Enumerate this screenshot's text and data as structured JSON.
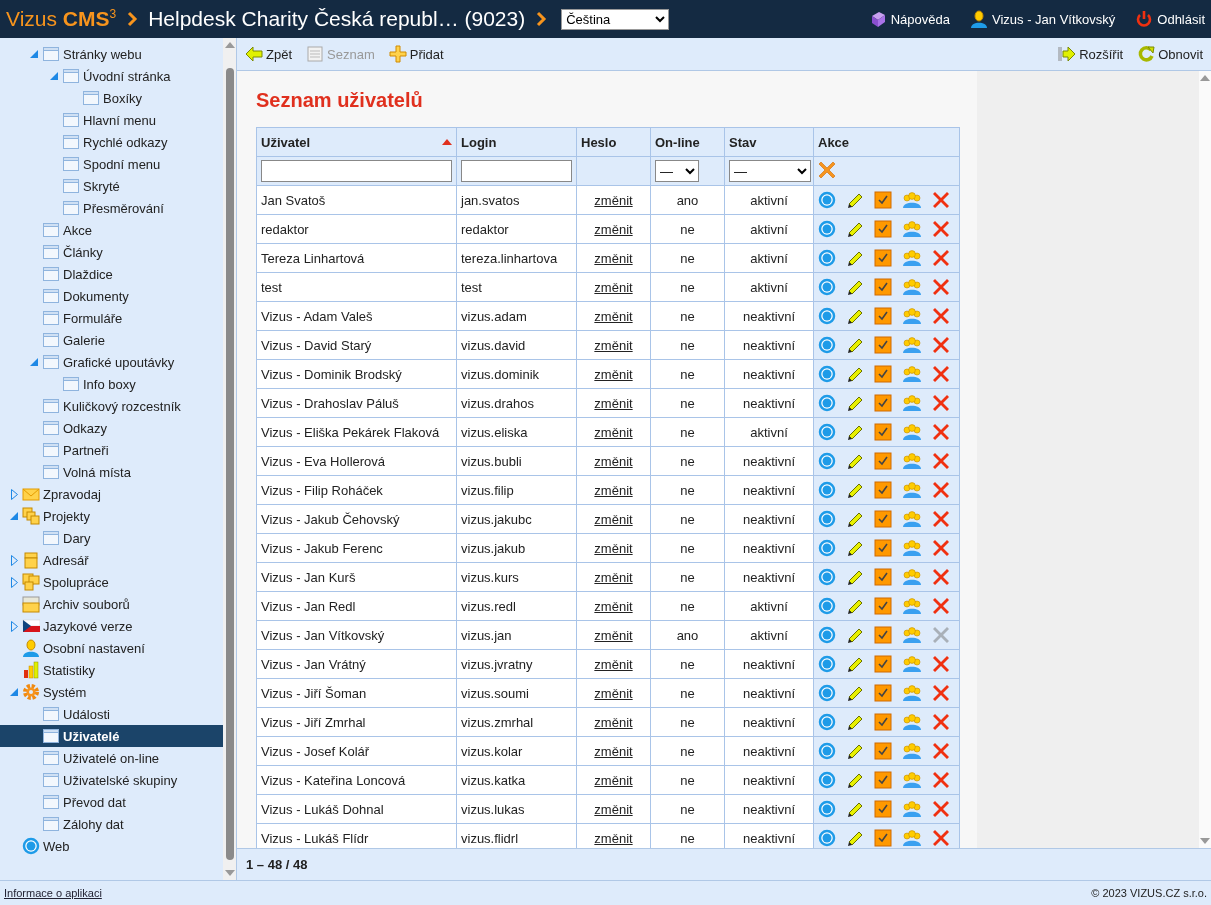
{
  "header": {
    "logo": "Vizus **CMS**$^{3}$",
    "site_title": "Helpdesk Charity Česká republ… (9023)",
    "language": "Čeština",
    "help": "Nápověda",
    "user": "Vizus - Jan Vítkovský",
    "logout": "Odhlásit"
  },
  "sidebar": {
    "items": [
      {
        "children": [
          {
            "label": "Stránky webu",
            "kind": "page",
            "expanded": true,
            "children": [
              {
                "label": "Úvodní stránka",
                "kind": "page",
                "expanded": true,
                "children": [
                  {
                    "label": "Boxíky",
                    "kind": "page",
                    "selected": false
                  }
                ],
                "selected": false
              },
              {
                "label": "Hlavní menu",
                "kind": "page",
                "selected": false
              },
              {
                "label": "Rychlé odkazy",
                "kind": "page",
                "selected": false
              },
              {
                "label": "Spodní menu",
                "kind": "page",
                "selected": false
              },
              {
                "label": "Skryté",
                "kind": "page",
                "selected": false
              },
              {
                "label": "Přesměrování",
                "kind": "page",
                "selected": false
              }
            ],
            "selected": false
          },
          {
            "label": "Akce",
            "kind": "page",
            "selected": false
          },
          {
            "label": "Články",
            "kind": "page",
            "selected": false
          },
          {
            "label": "Dlaždice",
            "kind": "page",
            "selected": false
          },
          {
            "label": "Dokumenty",
            "kind": "page",
            "selected": false
          },
          {
            "label": "Formuláře",
            "kind": "page",
            "selected": false
          },
          {
            "label": "Galerie",
            "kind": "page",
            "selected": false
          },
          {
            "label": "Grafické upoutávky",
            "kind": "page",
            "expanded": true,
            "children": [
              {
                "label": "Info boxy",
                "kind": "page",
                "selected": false
              }
            ],
            "selected": false
          },
          {
            "label": "Kuličkový rozcestník",
            "kind": "page",
            "selected": false
          },
          {
            "label": "Odkazy",
            "kind": "page",
            "selected": false
          },
          {
            "label": "Partneři",
            "kind": "page",
            "selected": false
          },
          {
            "label": "Volná místa",
            "kind": "page",
            "selected": false
          }
        ]
      },
      {
        "label": "Zpravodaj",
        "kind": "mail",
        "expanded": false,
        "selected": false
      },
      {
        "label": "Projekty",
        "kind": "projects",
        "expanded": true,
        "children": [
          {
            "label": "Dary",
            "kind": "page",
            "selected": false
          }
        ],
        "selected": false
      },
      {
        "label": "Adresář",
        "kind": "address",
        "expanded": false,
        "selected": false
      },
      {
        "label": "Spolupráce",
        "kind": "collab",
        "expanded": false,
        "selected": false
      },
      {
        "label": "Archiv souborů",
        "kind": "archive",
        "selected": false
      },
      {
        "label": "Jazykové verze",
        "kind": "flag",
        "expanded": false,
        "selected": false
      },
      {
        "label": "Osobní nastavení",
        "kind": "person",
        "selected": false
      },
      {
        "label": "Statistiky",
        "kind": "stats",
        "selected": false
      },
      {
        "label": "Systém",
        "kind": "gear",
        "expanded": true,
        "children": [
          {
            "label": "Události",
            "kind": "page",
            "selected": false
          },
          {
            "label": "Uživatelé",
            "kind": "page",
            "selected": true
          },
          {
            "label": "Uživatelé on-line",
            "kind": "page",
            "selected": false
          },
          {
            "label": "Uživatelské skupiny",
            "kind": "page",
            "selected": false
          },
          {
            "label": "Převod dat",
            "kind": "page",
            "selected": false
          },
          {
            "label": "Zálohy dat",
            "kind": "page",
            "selected": false
          }
        ],
        "selected": false
      },
      {
        "label": "Web",
        "kind": "web",
        "selected": false
      }
    ]
  },
  "toolbar": {
    "left": [
      {
        "label": "Zpět",
        "kind": "back",
        "disabled": false
      },
      {
        "label": "Seznam",
        "kind": "list",
        "disabled": true
      },
      {
        "label": "Přidat",
        "kind": "add",
        "disabled": false
      }
    ],
    "right": [
      {
        "label": "Rozšířit",
        "kind": "expand",
        "disabled": false
      },
      {
        "label": "Obnovit",
        "kind": "refresh",
        "disabled": false
      }
    ]
  },
  "page_title": "Seznam uživatelů",
  "table": {
    "columns": [
      {
        "label": "Uživatel",
        "sorted_ascending": true
      },
      {
        "label": "Login",
        "sorted_ascending": false
      },
      {
        "label": "Heslo",
        "sorted_ascending": false
      },
      {
        "label": "On-line",
        "sorted_ascending": false
      },
      {
        "label": "Stav",
        "sorted_ascending": false
      },
      {
        "label": "Akce",
        "sorted_ascending": false
      }
    ],
    "filters": [
      {
        "kind": "text"
      },
      {
        "kind": "text"
      },
      {
        "kind": "blank"
      },
      {
        "kind": "select",
        "value": "—"
      },
      {
        "kind": "select",
        "value": "—"
      },
      {
        "kind": "clear"
      }
    ],
    "rows": [
      {
        "user": "Jan Svatoš",
        "login": "jan.svatos",
        "password": "změnit",
        "online": "ano",
        "status": "aktivní",
        "delete_disabled": false
      },
      {
        "user": "redaktor",
        "login": "redaktor",
        "password": "změnit",
        "online": "ne",
        "status": "aktivní",
        "delete_disabled": false
      },
      {
        "user": "Tereza Linhartová",
        "login": "tereza.linhartova",
        "password": "změnit",
        "online": "ne",
        "status": "aktivní",
        "delete_disabled": false
      },
      {
        "user": "test",
        "login": "test",
        "password": "změnit",
        "online": "ne",
        "status": "aktivní",
        "delete_disabled": false
      },
      {
        "user": "Vizus - Adam Valeš",
        "login": "vizus.adam",
        "password": "změnit",
        "online": "ne",
        "status": "neaktivní",
        "delete_disabled": false
      },
      {
        "user": "Vizus - David Starý",
        "login": "vizus.david",
        "password": "změnit",
        "online": "ne",
        "status": "neaktivní",
        "delete_disabled": false
      },
      {
        "user": "Vizus - Dominik Brodský",
        "login": "vizus.dominik",
        "password": "změnit",
        "online": "ne",
        "status": "neaktivní",
        "delete_disabled": false
      },
      {
        "user": "Vizus - Drahoslav Páluš",
        "login": "vizus.drahos",
        "password": "změnit",
        "online": "ne",
        "status": "neaktivní",
        "delete_disabled": false
      },
      {
        "user": "Vizus - Eliška Pekárek Flaková",
        "login": "vizus.eliska",
        "password": "změnit",
        "online": "ne",
        "status": "aktivní",
        "delete_disabled": false
      },
      {
        "user": "Vizus - Eva Hollerová",
        "login": "vizus.bubli",
        "password": "změnit",
        "online": "ne",
        "status": "neaktivní",
        "delete_disabled": false
      },
      {
        "user": "Vizus - Filip Roháček",
        "login": "vizus.filip",
        "password": "změnit",
        "online": "ne",
        "status": "neaktivní",
        "delete_disabled": false
      },
      {
        "user": "Vizus - Jakub Čehovský",
        "login": "vizus.jakubc",
        "password": "změnit",
        "online": "ne",
        "status": "neaktivní",
        "delete_disabled": false
      },
      {
        "user": "Vizus - Jakub Ferenc",
        "login": "vizus.jakub",
        "password": "změnit",
        "online": "ne",
        "status": "neaktivní",
        "delete_disabled": false
      },
      {
        "user": "Vizus - Jan Kurš",
        "login": "vizus.kurs",
        "password": "změnit",
        "online": "ne",
        "status": "neaktivní",
        "delete_disabled": false
      },
      {
        "user": "Vizus - Jan Redl",
        "login": "vizus.redl",
        "password": "změnit",
        "online": "ne",
        "status": "aktivní",
        "delete_disabled": false
      },
      {
        "user": "Vizus - Jan Vítkovský",
        "login": "vizus.jan",
        "password": "změnit",
        "online": "ano",
        "status": "aktivní",
        "delete_disabled": true
      },
      {
        "user": "Vizus - Jan Vrátný",
        "login": "vizus.jvratny",
        "password": "změnit",
        "online": "ne",
        "status": "neaktivní",
        "delete_disabled": false
      },
      {
        "user": "Vizus - Jiří Šoman",
        "login": "vizus.soumi",
        "password": "změnit",
        "online": "ne",
        "status": "neaktivní",
        "delete_disabled": false
      },
      {
        "user": "Vizus - Jiří Zmrhal",
        "login": "vizus.zmrhal",
        "password": "změnit",
        "online": "ne",
        "status": "neaktivní",
        "delete_disabled": false
      },
      {
        "user": "Vizus - Josef Kolář",
        "login": "vizus.kolar",
        "password": "změnit",
        "online": "ne",
        "status": "neaktivní",
        "delete_disabled": false
      },
      {
        "user": "Vizus - Kateřina Loncová",
        "login": "vizus.katka",
        "password": "změnit",
        "online": "ne",
        "status": "neaktivní",
        "delete_disabled": false
      },
      {
        "user": "Vizus - Lukáš Dohnal",
        "login": "vizus.lukas",
        "password": "změnit",
        "online": "ne",
        "status": "neaktivní",
        "delete_disabled": false
      },
      {
        "user": "Vizus - Lukáš Flídr",
        "login": "vizus.flidrl",
        "password": "změnit",
        "online": "ne",
        "status": "neaktivní",
        "delete_disabled": false
      }
    ]
  },
  "pager": "1 – 48 / 48",
  "footer": {
    "link": "Informace o aplikaci",
    "copyright": "© 2023 VIZUS.CZ s.r.o."
  }
}
